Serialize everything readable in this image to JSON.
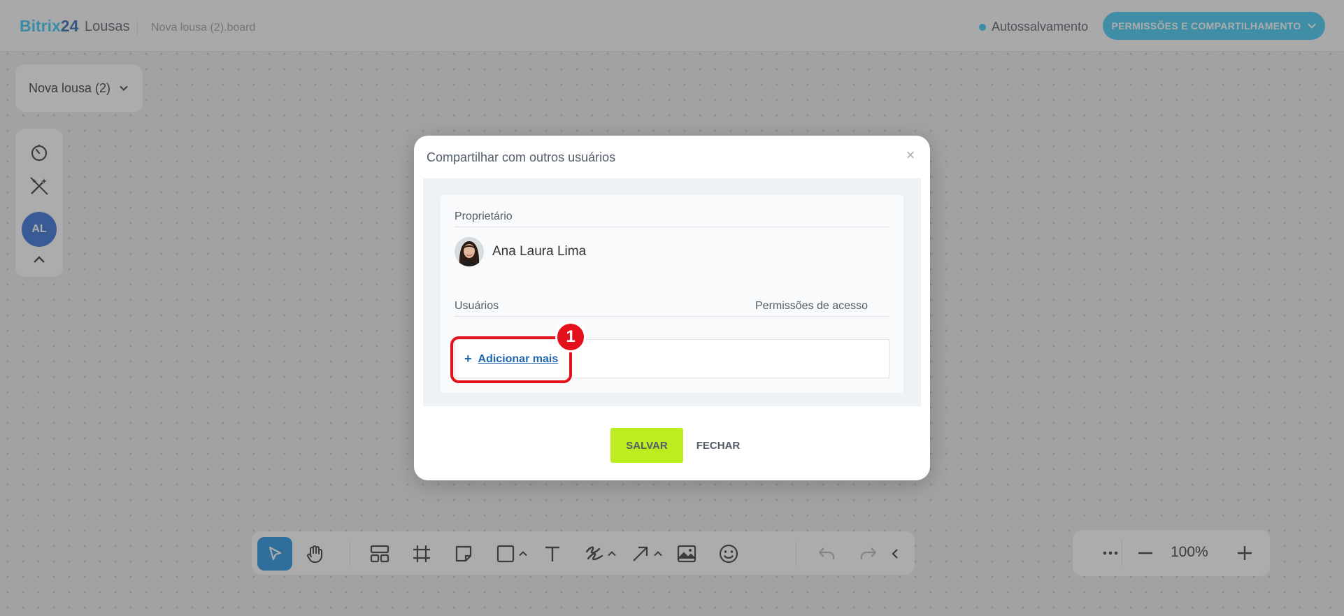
{
  "header": {
    "logo_main": "Bitrix",
    "logo_num": "24",
    "logo_sub": "Lousas",
    "file_name": "Nova lousa (2).board",
    "autosave_label": "Autossalvamento",
    "share_button_label": "PERMISSÕES E COMPARTILHAMENTO",
    "accent_color": "#3bc8f5"
  },
  "board": {
    "name": "Nova lousa (2)"
  },
  "left_toolbar": {
    "avatar_initials": "AL",
    "icons": [
      "timer-icon",
      "magic-wand-off-icon",
      "avatar",
      "chevron-up-icon"
    ]
  },
  "bottom_toolbar": {
    "tools": [
      "select-pointer-icon",
      "hand-pan-icon",
      "layout-template-icon",
      "frame-icon",
      "sticky-note-icon",
      "rectangle-shape-icon",
      "text-tool-icon",
      "pen-draw-icon",
      "arrow-connector-icon",
      "image-icon",
      "emoji-icon",
      "undo-icon",
      "redo-icon",
      "collapse-icon"
    ],
    "zoom_level": "100%"
  },
  "modal": {
    "title": "Compartilhar com outros usuários",
    "owner_section_label": "Proprietário",
    "owner_name": "Ana Laura Lima",
    "users_section_label": "Usuários",
    "permissions_column_label": "Permissões de acesso",
    "add_more_label": "Adicionar mais",
    "save_label": "SALVAR",
    "close_label": "FECHAR"
  },
  "annotation": {
    "badge_number": "1",
    "color": "#e3111b"
  }
}
